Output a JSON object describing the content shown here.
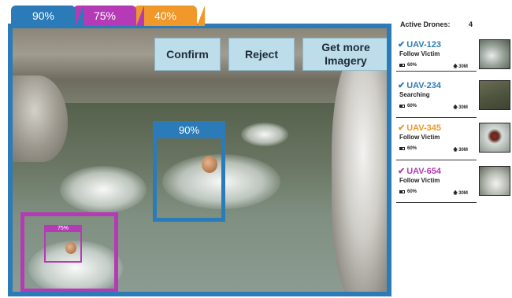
{
  "tabs": [
    {
      "label": "90%",
      "color": "#2b7bb9"
    },
    {
      "label": "75%",
      "color": "#b53ab5"
    },
    {
      "label": "40%",
      "color": "#f0982a"
    }
  ],
  "actions": {
    "confirm": "Confirm",
    "reject": "Reject",
    "more": "Get more Imagery"
  },
  "detections": [
    {
      "confidence": "90%",
      "color": "#2b7bb9"
    },
    {
      "confidence": "75%",
      "color": "#b53ab5"
    }
  ],
  "panel": {
    "active_label": "Active Drones:",
    "active_count": "4",
    "drones": [
      {
        "id": "UAV-123",
        "status": "Follow Victim",
        "battery": "60%",
        "altitude": "30M",
        "color": "#2b7bb9",
        "icon": "check-icon"
      },
      {
        "id": "UAV-234",
        "status": "Searching",
        "battery": "60%",
        "altitude": "30M",
        "color": "#2b7bb9",
        "icon": "check-icon"
      },
      {
        "id": "UAV-345",
        "status": "Follow Victim",
        "battery": "60%",
        "altitude": "30M",
        "color": "#f0982a",
        "icon": "check-icon"
      },
      {
        "id": "UAV-654",
        "status": "Follow Victim",
        "battery": "60%",
        "altitude": "30M",
        "color": "#b53ab5",
        "icon": "check-icon"
      }
    ]
  }
}
